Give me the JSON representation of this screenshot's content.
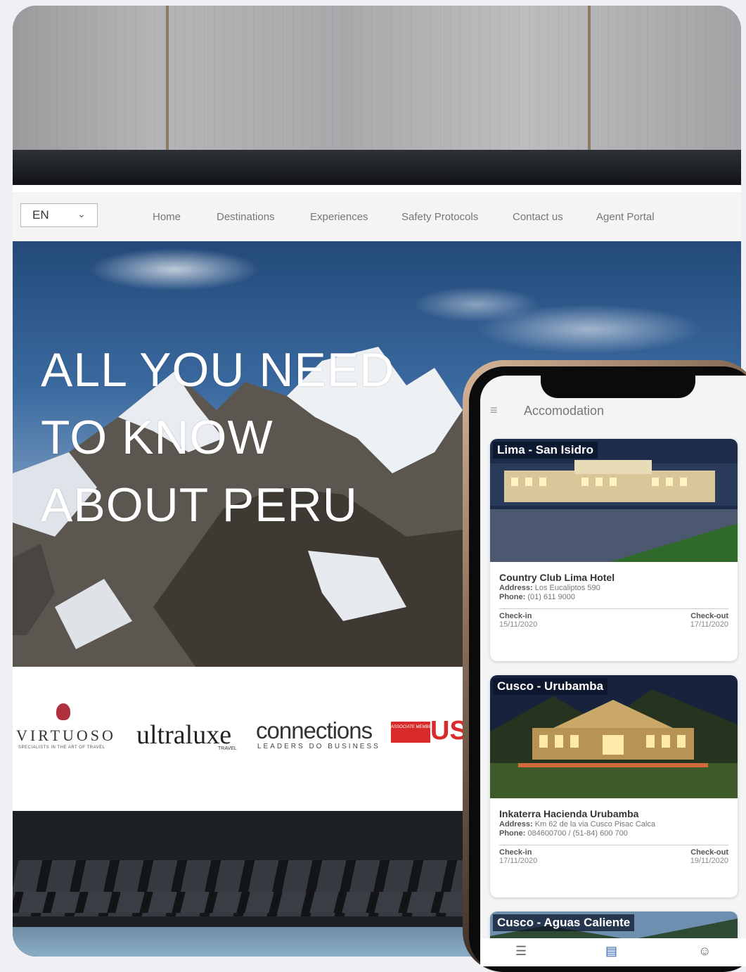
{
  "site": {
    "language": "EN",
    "nav": [
      "Home",
      "Destinations",
      "Experiences",
      "Safety Protocols",
      "Contact us",
      "Agent Portal"
    ],
    "hero_title": [
      "ALL YOU NEED",
      "TO KNOW",
      "ABOUT PERU"
    ]
  },
  "partners": {
    "virtuoso": "VIRTUOSO",
    "virtuoso_sub": "SPECIALISTS IN THE ART OF TRAVEL",
    "ultraluxe": "ultraluxe",
    "ultraluxe_sub": "TRAVEL",
    "connections": "connections",
    "connections_sub": "LEADERS DO BUSINESS",
    "asta_badge": "ASSOCIATE MEMBER",
    "us": "US"
  },
  "app": {
    "title": "Accomodation",
    "cards": [
      {
        "tag": "Lima - San Isidro",
        "hotel": "Country Club Lima Hotel",
        "address_label": "Address:",
        "address": "Los Eucaliptos 590",
        "phone_label": "Phone:",
        "phone": "(01) 611 9000",
        "checkin_label": "Check-in",
        "checkin": "15/11/2020",
        "checkout_label": "Check-out",
        "checkout": "17/11/2020"
      },
      {
        "tag": "Cusco - Urubamba",
        "hotel": "Inkaterra Hacienda Urubamba",
        "address_label": "Address:",
        "address": "Km 62 de la via Cusco Pisac Calca",
        "phone_label": "Phone:",
        "phone": "084600700 / (51-84) 600 700",
        "checkin_label": "Check-in",
        "checkin": "17/11/2020",
        "checkout_label": "Check-out",
        "checkout": "19/11/2020"
      },
      {
        "tag": "Cusco - Aguas Caliente"
      }
    ],
    "tabs": [
      "list-icon",
      "bed-icon",
      "profile-icon"
    ]
  },
  "colors": {
    "sky": "#3b6aa0",
    "asta_red": "#d82a2a",
    "card_tag_bg": "#0a1428"
  }
}
